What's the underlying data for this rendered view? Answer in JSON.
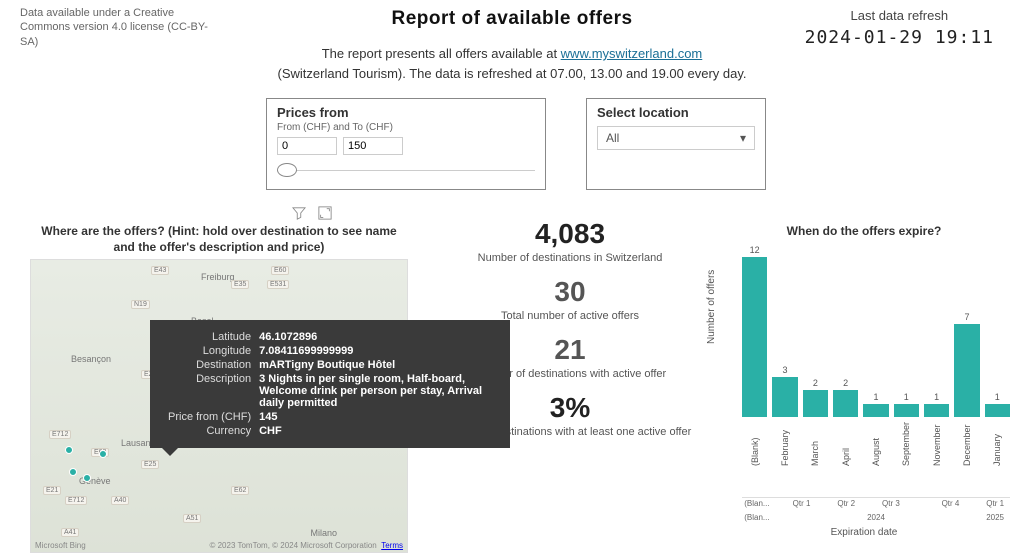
{
  "license": "Data available under a Creative Commons version 4.0 license (CC-BY-SA)",
  "title": "Report of available offers",
  "refresh": {
    "label": "Last data refresh",
    "value": "2024-01-29 19:11"
  },
  "subtitle": {
    "line1a": "The report presents all offers available at ",
    "link_text": "www.myswitzerland.com",
    "line2": "(Switzerland Tourism). The data is refreshed at 07.00, 13.00 and 19.00 every day."
  },
  "filters": {
    "prices": {
      "title": "Prices from",
      "sub": "From (CHF) and To (CHF)",
      "from": "0",
      "to": "150"
    },
    "location": {
      "title": "Select location",
      "selected": "All"
    }
  },
  "map": {
    "title": "Where are the offers? (Hint: hold over destination to see name and the offer's description and price)",
    "roads": [
      "E43",
      "E60",
      "E35",
      "E531",
      "N19",
      "E27",
      "E54",
      "E712",
      "E62",
      "E25",
      "E21",
      "E62",
      "A40",
      "E712",
      "A51",
      "A41"
    ],
    "cities": [
      "Freiburg",
      "Basel",
      "Besançon",
      "Lausanne",
      "Genève",
      "Milano"
    ],
    "attr_left": "Microsoft Bing",
    "attr_right": "© 2023 TomTom, © 2024 Microsoft Corporation",
    "attr_terms": "Terms"
  },
  "tooltip": {
    "Latitude": "46.1072896",
    "Longitude": "7.08411699999999",
    "Destination": "mARTigny Boutique Hôtel",
    "Description": "3 Nights in per single room, Half-board, Welcome drink per person per stay, Arrival daily permitted",
    "PriceFromLabel": "Price from (CHF)",
    "PriceFrom": "145",
    "Currency": "CHF"
  },
  "kpis": [
    {
      "value": "4,083",
      "label": "Number of destinations in Switzerland"
    },
    {
      "value": "30",
      "label": "Total number of active offers",
      "partial": true
    },
    {
      "value": "21",
      "label": "Number of destinations with active offer",
      "partial": true
    },
    {
      "value": "3%",
      "label": "Share of destinations with at least one active offer"
    }
  ],
  "chart_data": {
    "type": "bar",
    "title": "When do the offers expire?",
    "ylabel": "Number of offers",
    "xlabel": "Expiration date",
    "categories": [
      "(Blank)",
      "February",
      "March",
      "April",
      "August",
      "September",
      "November",
      "December",
      "January"
    ],
    "values": [
      12,
      3,
      2,
      2,
      1,
      1,
      1,
      7,
      1
    ],
    "groups_level1": {
      "labels": [
        "(Blan...",
        "Qtr 1",
        "Qtr 2",
        "Qtr 3",
        "Qtr 4",
        "Qtr 1"
      ],
      "spans": [
        1,
        2,
        1,
        2,
        2,
        1
      ]
    },
    "groups_level2": {
      "labels": [
        "(Blan...",
        "2024",
        "2025"
      ],
      "spans": [
        1,
        7,
        1
      ]
    },
    "ylim": [
      0,
      12
    ]
  }
}
